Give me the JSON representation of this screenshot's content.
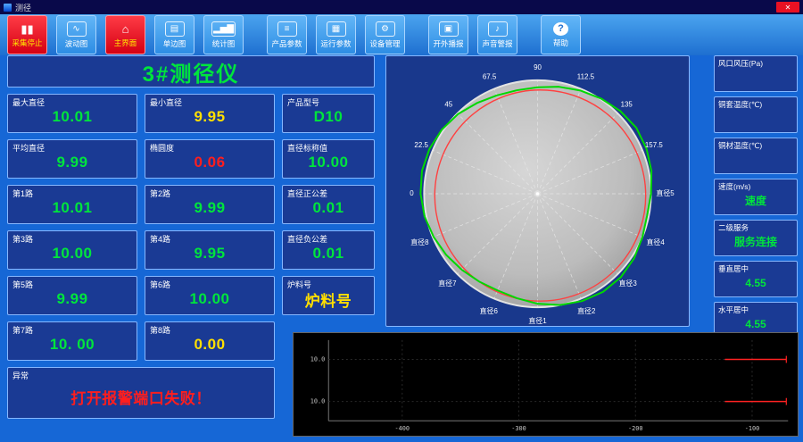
{
  "window": {
    "title": "测径",
    "close_label": "✕"
  },
  "colors": {
    "green": "#00e53c",
    "yellow": "#ffdf00",
    "red": "#ff1e1e",
    "panel_bg": "#1a3a94",
    "panel_border": "#86b7ff",
    "page_bg": "#1667d6"
  },
  "toolbar": {
    "buttons": [
      {
        "label": "采集停止",
        "name": "stop-acquisition",
        "icon": "stop-bars-icon",
        "glyph": "▮▮",
        "variant": "red",
        "group_gap": false
      },
      {
        "label": "波动图",
        "name": "wave-chart",
        "icon": "waveform-icon",
        "glyph": "∿",
        "variant": "blue",
        "group_gap": false
      },
      {
        "label": "主界面",
        "name": "main-screen",
        "icon": "home-icon",
        "glyph": "⌂",
        "variant": "red",
        "group_gap": false
      },
      {
        "label": "单边图",
        "name": "single-side-chart",
        "icon": "panels-icon",
        "glyph": "▤",
        "variant": "blue",
        "group_gap": false
      },
      {
        "label": "统计图",
        "name": "statistics-chart",
        "icon": "bar-chart-icon",
        "glyph": "▂▅▇",
        "variant": "blue",
        "group_gap": false
      },
      {
        "label": "产品参数",
        "name": "product-params",
        "icon": "product-params-icon",
        "glyph": "≡",
        "variant": "blue",
        "group_gap": true
      },
      {
        "label": "运行参数",
        "name": "run-params",
        "icon": "run-params-icon",
        "glyph": "▦",
        "variant": "blue",
        "group_gap": false
      },
      {
        "label": "设备管理",
        "name": "device-management",
        "icon": "device-manage-icon",
        "glyph": "⚙",
        "variant": "blue",
        "group_gap": false
      },
      {
        "label": "开外播报",
        "name": "external-broadcast",
        "icon": "broadcast-icon",
        "glyph": "▣",
        "variant": "blue",
        "group_gap": true
      },
      {
        "label": "声音警报",
        "name": "sound-alarm",
        "icon": "sound-alarm-icon",
        "glyph": "♪",
        "variant": "blue",
        "group_gap": false
      },
      {
        "label": "帮助",
        "name": "help",
        "icon": "help-icon",
        "glyph": "?",
        "variant": "blue",
        "group_gap": true
      }
    ]
  },
  "gauge": {
    "title": "3#测径仪"
  },
  "fields": [
    {
      "name": "max-diameter",
      "label": "最大直径",
      "value": "10.01",
      "color": "green"
    },
    {
      "name": "min-diameter",
      "label": "最小直径",
      "value": "9.95",
      "color": "yellow"
    },
    {
      "name": "product-model",
      "label": "产品型号",
      "value": "D10",
      "color": "green"
    },
    {
      "name": "avg-diameter",
      "label": "平均直径",
      "value": "9.99",
      "color": "green"
    },
    {
      "name": "ovality",
      "label": "椭圆度",
      "value": "0.06",
      "color": "red-text"
    },
    {
      "name": "nominal-diameter",
      "label": "直径标称值",
      "value": "10.00",
      "color": "green"
    },
    {
      "name": "path-1",
      "label": "第1路",
      "value": "10.01",
      "color": "green"
    },
    {
      "name": "path-2",
      "label": "第2路",
      "value": "9.99",
      "color": "green"
    },
    {
      "name": "diameter-pos-tolerance",
      "label": "直径正公差",
      "value": "0.01",
      "color": "green"
    },
    {
      "name": "path-3",
      "label": "第3路",
      "value": "10.00",
      "color": "green"
    },
    {
      "name": "path-4",
      "label": "第4路",
      "value": "9.95",
      "color": "green"
    },
    {
      "name": "diameter-neg-tolerance",
      "label": "直径负公差",
      "value": "0.01",
      "color": "green"
    },
    {
      "name": "path-5",
      "label": "第5路",
      "value": "9.99",
      "color": "green"
    },
    {
      "name": "path-6",
      "label": "第6路",
      "value": "10.00",
      "color": "green"
    },
    {
      "name": "batch-number",
      "label": "炉料号",
      "value": "炉料号",
      "color": "yellow"
    },
    {
      "name": "path-7",
      "label": "第7路",
      "value": "10. 00",
      "color": "green"
    },
    {
      "name": "path-8",
      "label": "第8路",
      "value": "0.00",
      "color": "yellow"
    }
  ],
  "alarm": {
    "label": "异常",
    "value": "打开报警端口失败！"
  },
  "right_panel": [
    {
      "name": "air-pressure",
      "label": "风口风压(Pa)",
      "value": "",
      "color": "green"
    },
    {
      "name": "sleeve-temperature",
      "label": "铜套温度(℃)",
      "value": "",
      "color": "green"
    },
    {
      "name": "copper-temperature",
      "label": "铜材温度(℃)",
      "value": "",
      "color": "green"
    },
    {
      "name": "speed",
      "label": "速度(m/s)",
      "value": "速度",
      "color": "green"
    },
    {
      "name": "l2-service",
      "label": "二级服务",
      "value": "服务连接",
      "color": "green"
    },
    {
      "name": "vertical-center",
      "label": "垂直居中",
      "value": "4.55",
      "color": "green"
    },
    {
      "name": "horizontal-center",
      "label": "水平居中",
      "value": "4.55",
      "color": "green"
    }
  ],
  "polar": {
    "angle_labels": [
      "0",
      "22.5",
      "45",
      "67.5",
      "90",
      "112.5",
      "135",
      "157.5"
    ],
    "diameter_labels": [
      "直径1",
      "直径2",
      "直径3",
      "直径4",
      "直径5",
      "直径6",
      "直径7",
      "直径8"
    ],
    "green_profile": [
      128,
      131,
      133,
      134,
      132,
      129,
      126,
      123,
      120,
      119,
      120,
      123,
      127,
      130,
      132,
      133,
      132,
      130,
      127,
      124,
      121,
      119,
      118,
      120,
      124,
      128,
      131,
      133,
      133,
      131,
      128,
      126
    ],
    "red_radius": 119
  },
  "trend": {
    "y_ticks": [
      "10.0",
      "10.0"
    ],
    "x_ticks": [
      "-400",
      "-300",
      "-200",
      "-100"
    ]
  }
}
